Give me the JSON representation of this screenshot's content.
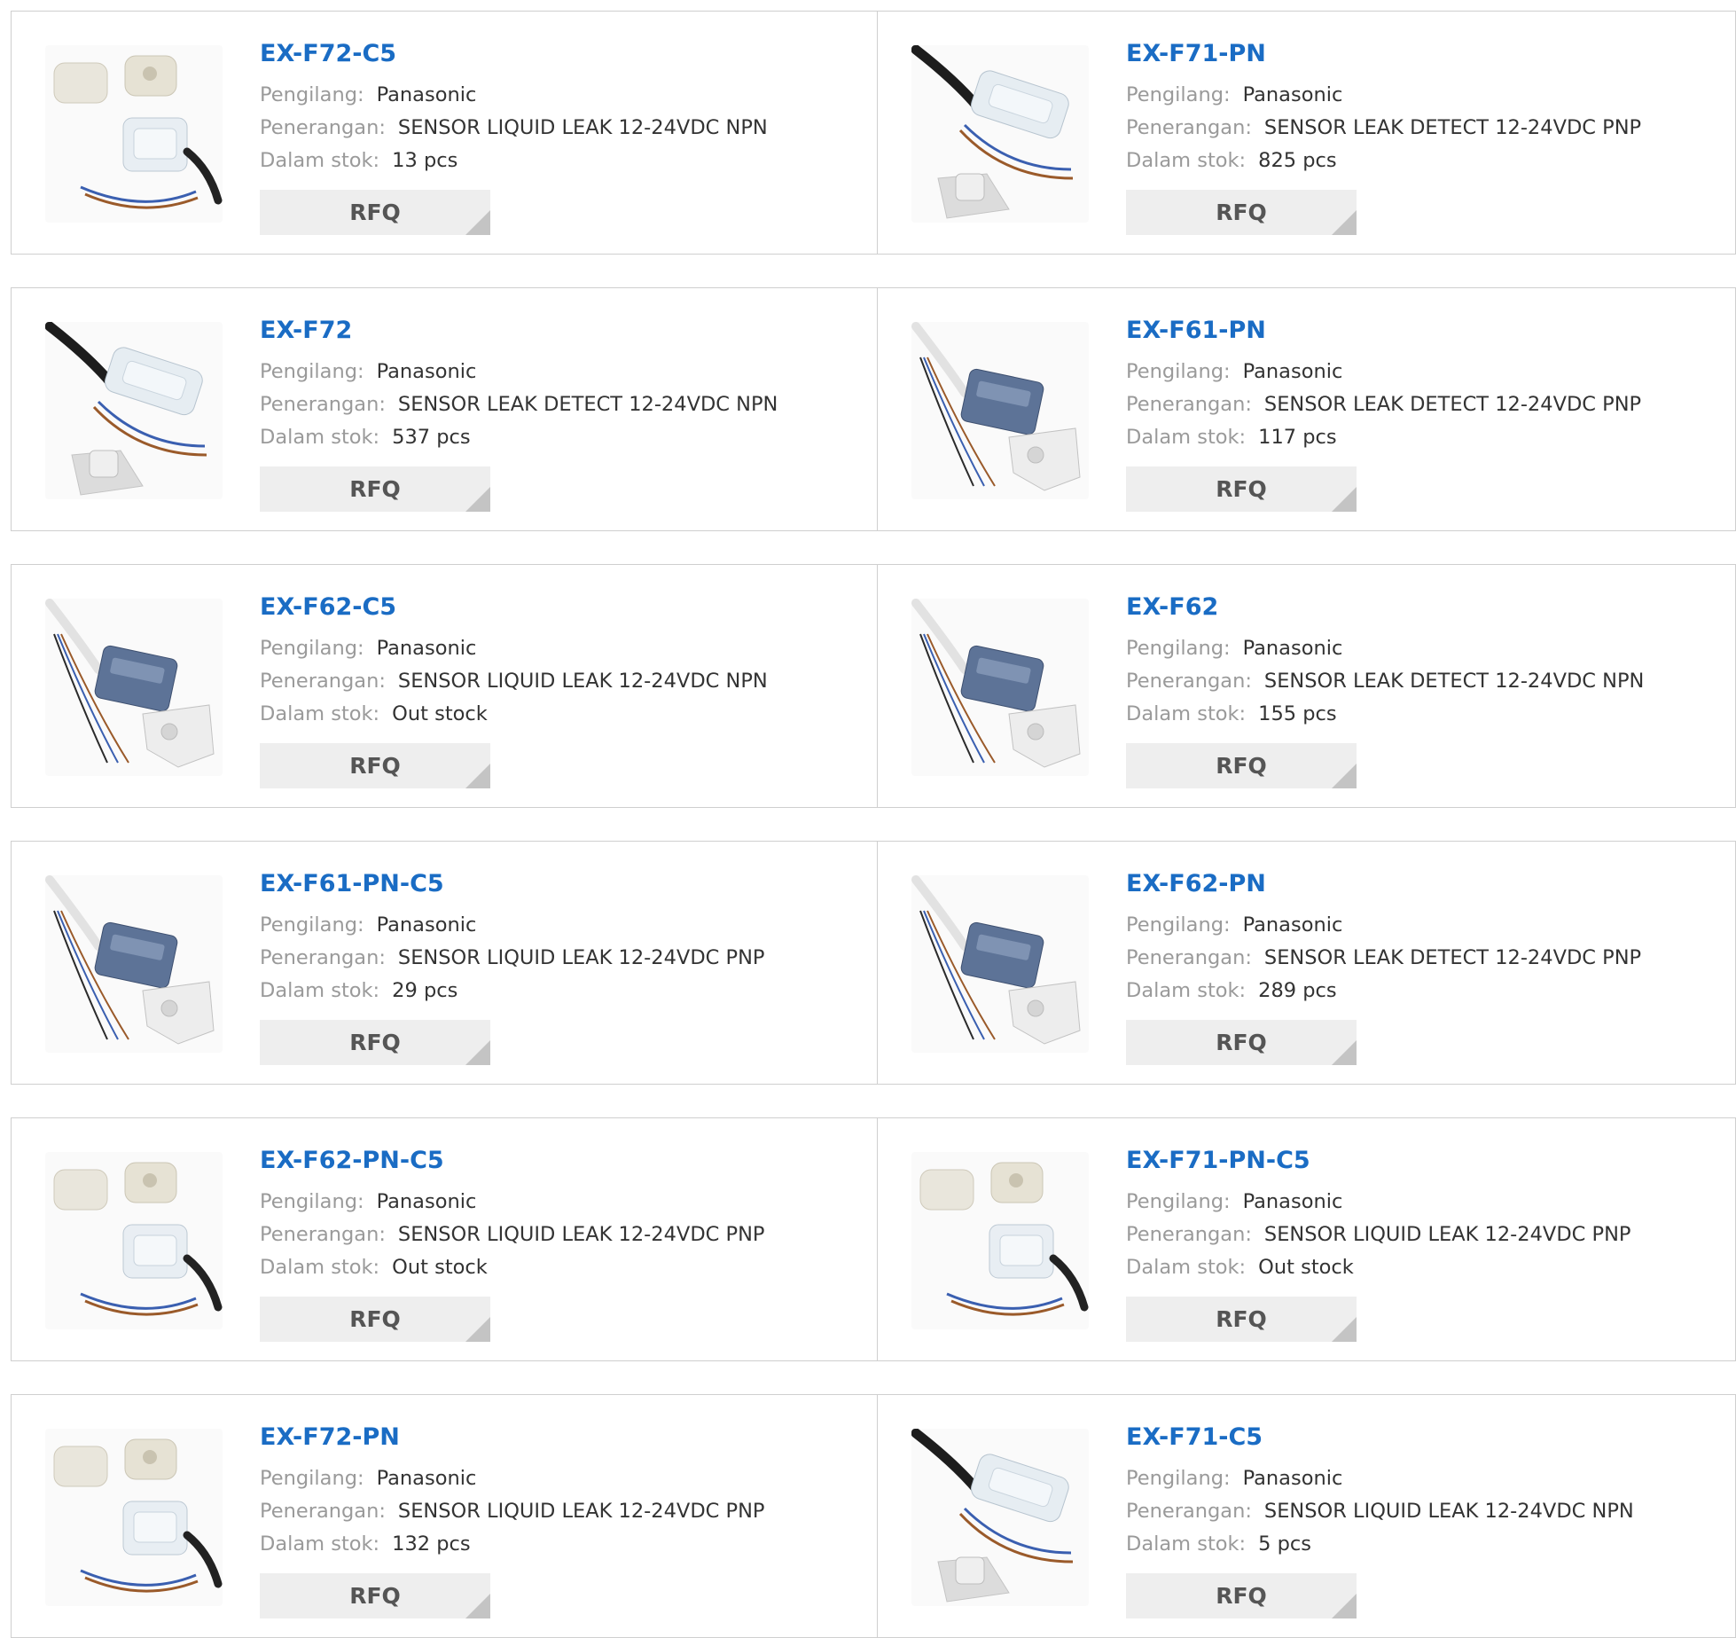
{
  "labels": {
    "manufacturer": "Pengilang:",
    "description": "Penerangan:",
    "stock": "Dalam stok:",
    "rfq": "RFQ"
  },
  "colors": {
    "part_link": "#1a6cc4",
    "rfq_bg": "#eeeeee",
    "border": "#cfcfcf"
  },
  "products": [
    {
      "part": "EX-F72-C5",
      "manufacturer": "Panasonic",
      "description": "SENSOR LIQUID LEAK 12-24VDC NPN",
      "stock": "13 pcs",
      "image": "clear-housing-with-mounts"
    },
    {
      "part": "EX-F71-PN",
      "manufacturer": "Panasonic",
      "description": "SENSOR LEAK DETECT 12-24VDC PNP",
      "stock": "825 pcs",
      "image": "clear-housing-with-cable"
    },
    {
      "part": "EX-F72",
      "manufacturer": "Panasonic",
      "description": "SENSOR LEAK DETECT 12-24VDC NPN",
      "stock": "537 pcs",
      "image": "clear-housing-with-cable"
    },
    {
      "part": "EX-F61-PN",
      "manufacturer": "Panasonic",
      "description": "SENSOR LEAK DETECT 12-24VDC PNP",
      "stock": "117 pcs",
      "image": "blue-sensor-with-bracket"
    },
    {
      "part": "EX-F62-C5",
      "manufacturer": "Panasonic",
      "description": "SENSOR LIQUID LEAK 12-24VDC NPN",
      "stock": "Out stock",
      "image": "blue-sensor-with-bracket"
    },
    {
      "part": "EX-F62",
      "manufacturer": "Panasonic",
      "description": "SENSOR LEAK DETECT 12-24VDC NPN",
      "stock": "155 pcs",
      "image": "blue-sensor-with-bracket"
    },
    {
      "part": "EX-F61-PN-C5",
      "manufacturer": "Panasonic",
      "description": "SENSOR LIQUID LEAK 12-24VDC PNP",
      "stock": "29 pcs",
      "image": "blue-sensor-with-bracket"
    },
    {
      "part": "EX-F62-PN",
      "manufacturer": "Panasonic",
      "description": "SENSOR LEAK DETECT 12-24VDC PNP",
      "stock": "289 pcs",
      "image": "blue-sensor-with-bracket"
    },
    {
      "part": "EX-F62-PN-C5",
      "manufacturer": "Panasonic",
      "description": "SENSOR LIQUID LEAK 12-24VDC PNP",
      "stock": "Out stock",
      "image": "clear-housing-with-mounts"
    },
    {
      "part": "EX-F71-PN-C5",
      "manufacturer": "Panasonic",
      "description": "SENSOR LIQUID LEAK 12-24VDC PNP",
      "stock": "Out stock",
      "image": "clear-housing-with-mounts"
    },
    {
      "part": "EX-F72-PN",
      "manufacturer": "Panasonic",
      "description": "SENSOR LIQUID LEAK 12-24VDC PNP",
      "stock": "132 pcs",
      "image": "clear-housing-with-mounts"
    },
    {
      "part": "EX-F71-C5",
      "manufacturer": "Panasonic",
      "description": "SENSOR LIQUID LEAK 12-24VDC NPN",
      "stock": "5 pcs",
      "image": "clear-housing-with-cable"
    }
  ]
}
